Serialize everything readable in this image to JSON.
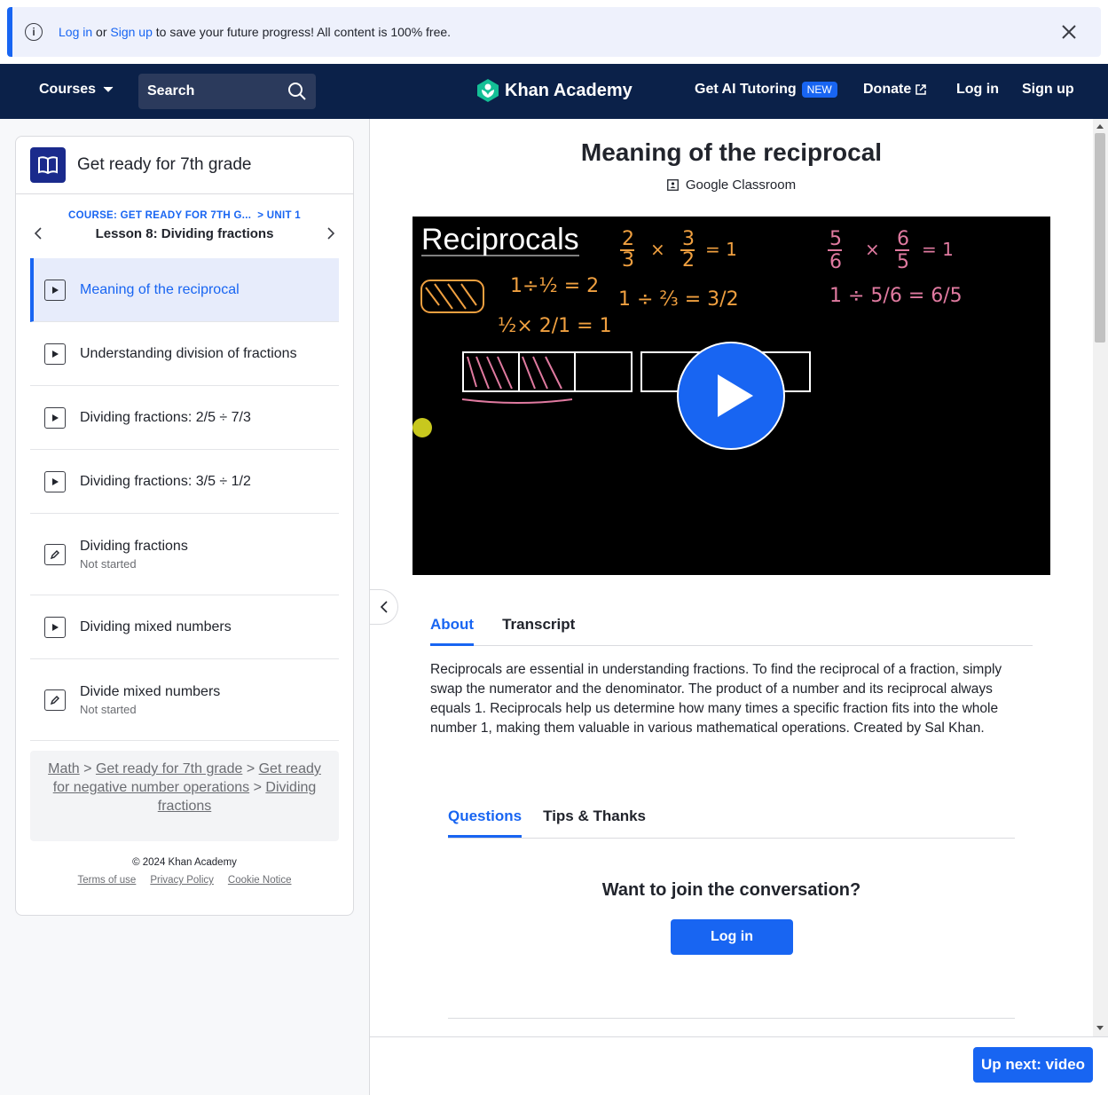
{
  "banner": {
    "login": "Log in",
    "or": "or",
    "signup": "Sign up",
    "message": "to save your future progress! All content is 100% free."
  },
  "nav": {
    "courses": "Courses",
    "search_placeholder": "Search",
    "logo": "Khan Academy",
    "ai_tutoring": "Get AI Tutoring",
    "new_badge": "NEW",
    "donate": "Donate",
    "login": "Log in",
    "signup": "Sign up"
  },
  "sidebar": {
    "course_title": "Get ready for 7th grade",
    "crumb_course": "COURSE: GET READY FOR 7TH G...",
    "crumb_unit": "> UNIT 1",
    "lesson": "Lesson 8: Dividing fractions",
    "items": [
      {
        "label": "Meaning of the reciprocal",
        "type": "video",
        "status": ""
      },
      {
        "label": "Understanding division of fractions",
        "type": "video",
        "status": ""
      },
      {
        "label": "Dividing fractions: 2/5 ÷ 7/3",
        "type": "video",
        "status": ""
      },
      {
        "label": "Dividing fractions: 3/5 ÷ 1/2",
        "type": "video",
        "status": ""
      },
      {
        "label": "Dividing fractions",
        "type": "exercise",
        "status": "Not started"
      },
      {
        "label": "Dividing mixed numbers",
        "type": "video",
        "status": ""
      },
      {
        "label": "Divide mixed numbers",
        "type": "exercise",
        "status": "Not started"
      }
    ],
    "breadcrumbs": [
      "Math",
      "Get ready for 7th grade",
      "Get ready for negative number operations",
      "Dividing fractions"
    ],
    "copyright": "© 2024 Khan Academy",
    "footer_links": [
      "Terms of use",
      "Privacy Policy",
      "Cookie Notice"
    ]
  },
  "main": {
    "title": "Meaning of the reciprocal",
    "google_classroom": "Google Classroom",
    "video_board_title": "Reciprocals",
    "tabs": [
      "About",
      "Transcript"
    ],
    "description": "Reciprocals are essential in understanding fractions. To find the reciprocal of a fraction, simply swap the numerator and the denominator. The product of a number and its reciprocal always equals 1. Reciprocals help us determine how many times a specific fraction fits into the whole number 1, making them valuable in various mathematical operations. Created by Sal Khan.",
    "discussion_tabs": [
      "Questions",
      "Tips & Thanks"
    ],
    "join_prompt": "Want to join the conversation?",
    "login_button": "Log in",
    "up_next": "Up next: video"
  },
  "colors": {
    "accent": "#1865f2",
    "nav_bg": "#0b2149",
    "logo_green": "#14bf96"
  }
}
